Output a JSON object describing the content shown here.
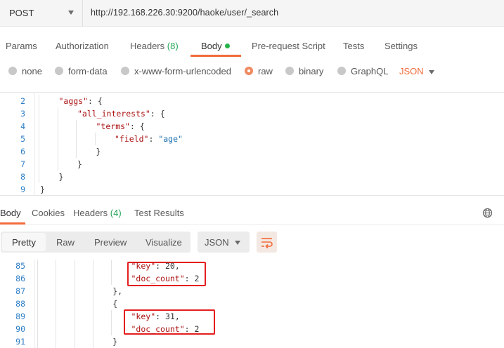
{
  "request": {
    "method": "POST",
    "url": "http://192.168.226.30:9200/haoke/user/_search"
  },
  "request_tabs": [
    {
      "label": "Params"
    },
    {
      "label": "Authorization"
    },
    {
      "label": "Headers",
      "count": "(8)"
    },
    {
      "label": "Body",
      "active": true
    },
    {
      "label": "Pre-request Script"
    },
    {
      "label": "Tests"
    },
    {
      "label": "Settings"
    }
  ],
  "body_types": [
    {
      "label": "none"
    },
    {
      "label": "form-data"
    },
    {
      "label": "x-www-form-urlencoded"
    },
    {
      "label": "raw",
      "selected": true
    },
    {
      "label": "binary"
    },
    {
      "label": "GraphQL"
    }
  ],
  "body_format": "JSON",
  "request_code": [
    {
      "n": "2",
      "indent": 1,
      "tokens": [
        {
          "t": "\"aggs\"",
          "c": "k"
        },
        {
          "t": ": {"
        }
      ]
    },
    {
      "n": "3",
      "indent": 2,
      "tokens": [
        {
          "t": "\"all_interests\"",
          "c": "k"
        },
        {
          "t": ": {"
        }
      ]
    },
    {
      "n": "4",
      "indent": 3,
      "tokens": [
        {
          "t": "\"terms\"",
          "c": "k"
        },
        {
          "t": ": {"
        }
      ]
    },
    {
      "n": "5",
      "indent": 4,
      "tokens": [
        {
          "t": "\"field\"",
          "c": "k"
        },
        {
          "t": ": "
        },
        {
          "t": "\"age\"",
          "c": "s"
        }
      ]
    },
    {
      "n": "6",
      "indent": 3,
      "tokens": [
        {
          "t": "}"
        }
      ]
    },
    {
      "n": "7",
      "indent": 2,
      "tokens": [
        {
          "t": "}"
        }
      ]
    },
    {
      "n": "8",
      "indent": 1,
      "tokens": [
        {
          "t": "}"
        }
      ]
    },
    {
      "n": "9",
      "indent": 0,
      "tokens": [
        {
          "t": "}"
        }
      ]
    }
  ],
  "response_tabs": [
    {
      "label": "Body",
      "active": true
    },
    {
      "label": "Cookies"
    },
    {
      "label": "Headers",
      "count": "(4)"
    },
    {
      "label": "Test Results"
    }
  ],
  "view_modes": [
    {
      "label": "Pretty",
      "active": true
    },
    {
      "label": "Raw"
    },
    {
      "label": "Preview"
    },
    {
      "label": "Visualize"
    }
  ],
  "response_format": "JSON",
  "response_code": [
    {
      "n": "85",
      "indent": 5,
      "tokens": [
        {
          "t": "\"key\"",
          "c": "k"
        },
        {
          "t": ": 20,"
        }
      ]
    },
    {
      "n": "86",
      "indent": 5,
      "tokens": [
        {
          "t": "\"doc_count\"",
          "c": "k"
        },
        {
          "t": ": 2"
        }
      ]
    },
    {
      "n": "87",
      "indent": 4,
      "tokens": [
        {
          "t": "},"
        }
      ]
    },
    {
      "n": "88",
      "indent": 4,
      "tokens": [
        {
          "t": "{"
        }
      ]
    },
    {
      "n": "89",
      "indent": 5,
      "tokens": [
        {
          "t": "\"key\"",
          "c": "k"
        },
        {
          "t": ": 31,"
        }
      ]
    },
    {
      "n": "90",
      "indent": 5,
      "tokens": [
        {
          "t": "\"doc_count\"",
          "c": "k"
        },
        {
          "t": ": 2"
        }
      ]
    },
    {
      "n": "91",
      "indent": 4,
      "tokens": [
        {
          "t": "}"
        }
      ]
    }
  ],
  "colors": {
    "accent": "#f26b3a",
    "count": "#26a65b",
    "highlight_box": "#e41e1e",
    "json_key": "#aa1111",
    "json_string": "#1a6fb0",
    "line_number": "#2d7ec6"
  },
  "icons": {
    "method_dropdown": "chevron-down-icon",
    "body_dot": "green-dot-icon",
    "format_dropdown": "chevron-down-icon",
    "globe": "globe-icon",
    "wrap": "wrap-lines-icon"
  }
}
